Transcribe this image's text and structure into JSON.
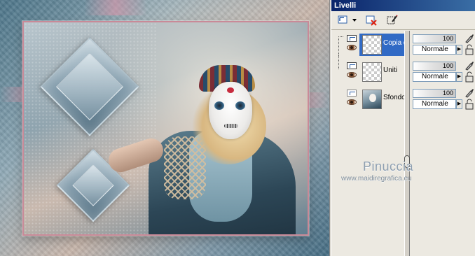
{
  "panel": {
    "title": "Livelli",
    "toolbar": {
      "new_layer_icon": "new-raster-layer-icon",
      "dropdown_icon": "dropdown-arrow-icon",
      "delete_icon": "delete-layer-icon",
      "edit_selection_icon": "edit-selection-icon"
    },
    "layers": [
      {
        "name": "Copia di Uniti",
        "selected": true,
        "thumbnail": "transparent",
        "opacity": "100",
        "blend": "Normale",
        "grouped": true
      },
      {
        "name": "Uniti",
        "selected": false,
        "thumbnail": "transparent",
        "opacity": "100",
        "blend": "Normale",
        "grouped": true
      },
      {
        "name": "Sfondo",
        "selected": false,
        "thumbnail": "photo",
        "opacity": "100",
        "blend": "Normale",
        "grouped": false
      }
    ]
  },
  "watermark": {
    "name": "Pinuccia",
    "url": "www.maidiregrafica.eu"
  },
  "colors": {
    "title_bar": "#0a246a",
    "selection": "#316ac5",
    "frame_border": "#c98a98"
  }
}
